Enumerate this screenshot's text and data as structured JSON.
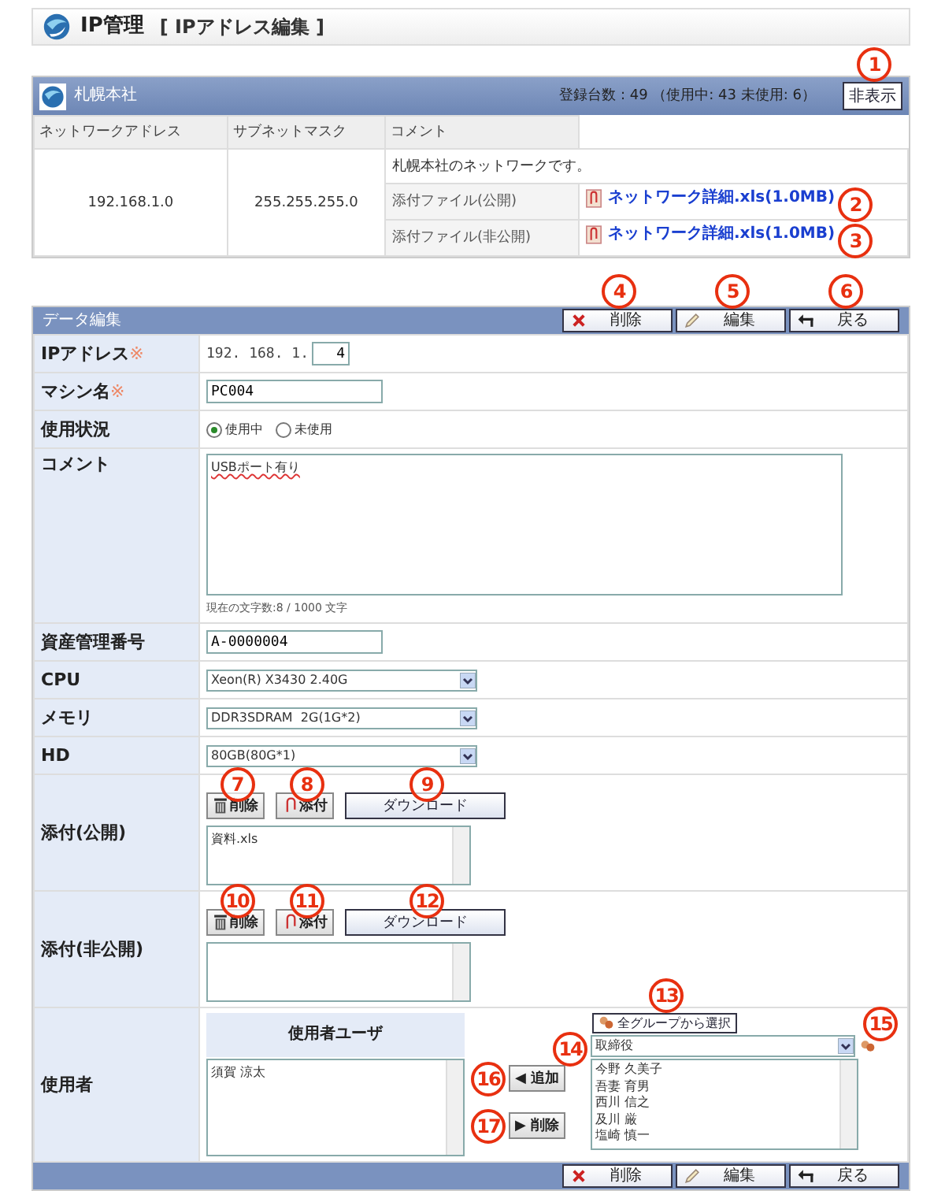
{
  "header": {
    "title": "IP管理",
    "subtitle": "[ IPアドレス編集 ]"
  },
  "office": {
    "name": "札幌本社",
    "summary": "登録台数 : 49 （使用中: 43 未使用: 6）",
    "toggle": {
      "label": "非表示",
      "callout": "1"
    },
    "columns": [
      "ネットワークアドレス",
      "サブネットマスク",
      "コメント"
    ],
    "network_address": "192.168.1.0",
    "subnet_mask": "255.255.255.0",
    "comment": "札幌本社のネットワークです。",
    "attachments": [
      {
        "label": "添付ファイル(公開)",
        "file": "ネットワーク詳細.xls(1.0MB)",
        "callout": "2"
      },
      {
        "label": "添付ファイル(非公開)",
        "file": "ネットワーク詳細.xls(1.0MB)",
        "callout": "3"
      }
    ]
  },
  "edit": {
    "title": "データ編集",
    "actions": [
      {
        "kind": "delete",
        "label": "削除",
        "callout": "4"
      },
      {
        "kind": "edit",
        "label": "編集",
        "callout": "5"
      },
      {
        "kind": "back",
        "label": "戻る",
        "callout": "6"
      }
    ],
    "fields": [
      {
        "kind": "ip",
        "label": "IPアドレス",
        "mark": "※",
        "prefix": "192. 168. 1.",
        "value": "4"
      },
      {
        "kind": "text",
        "label": "マシン名",
        "mark": "※",
        "value": "PC004"
      },
      {
        "kind": "radio",
        "label": "使用状況",
        "options": [
          {
            "label": "使用中",
            "selected": true
          },
          {
            "label": "未使用",
            "selected": false
          }
        ]
      },
      {
        "kind": "textarea",
        "label": "コメント",
        "value": "USBポート有り",
        "counter": "現在の文字数:8 / 1000 文字"
      },
      {
        "kind": "text",
        "label": "資産管理番号",
        "value": "A-0000004"
      },
      {
        "kind": "select",
        "label": "CPU",
        "value": "Xeon(R) X3430 2.40G"
      },
      {
        "kind": "select",
        "label": "メモリ",
        "value": "DDR3SDRAM  2G(1G*2)"
      },
      {
        "kind": "select",
        "label": "HD",
        "value": "80GB(80G*1)"
      },
      {
        "kind": "attachment",
        "label": "添付(公開)",
        "buttons": [
          {
            "kind": "delete",
            "label": "削除",
            "callout": "7"
          },
          {
            "kind": "attach",
            "label": "添付",
            "callout": "8"
          },
          {
            "kind": "download",
            "label": "ダウンロード",
            "callout": "9"
          }
        ],
        "files": [
          "資料.xls"
        ]
      },
      {
        "kind": "attachment",
        "label": "添付(非公開)",
        "buttons": [
          {
            "kind": "delete",
            "label": "削除",
            "callout": "10"
          },
          {
            "kind": "attach",
            "label": "添付",
            "callout": "11"
          },
          {
            "kind": "download",
            "label": "ダウンロード",
            "callout": "12"
          }
        ]
      },
      {
        "kind": "users",
        "label": "使用者",
        "heading": "使用者ユーザ",
        "selected_users": [
          "須賀 涼太"
        ],
        "add": {
          "icon": "◀",
          "label": "追加",
          "callout": "16"
        },
        "remove": {
          "icon": "▶",
          "label": "削除",
          "callout": "17"
        },
        "group_button": {
          "label": "全グループから選択",
          "callout": "13"
        },
        "group_select": {
          "value": "取締役",
          "callout": "14"
        },
        "refresh_callout": "15",
        "candidates": [
          "今野 久美子",
          "吾妻 育男",
          "西川 信之",
          "及川 厳",
          "塩崎 慎一"
        ]
      }
    ]
  },
  "footer_actions": [
    {
      "kind": "delete",
      "label": "削除"
    },
    {
      "kind": "edit",
      "label": "編集"
    },
    {
      "kind": "back",
      "label": "戻る"
    }
  ]
}
